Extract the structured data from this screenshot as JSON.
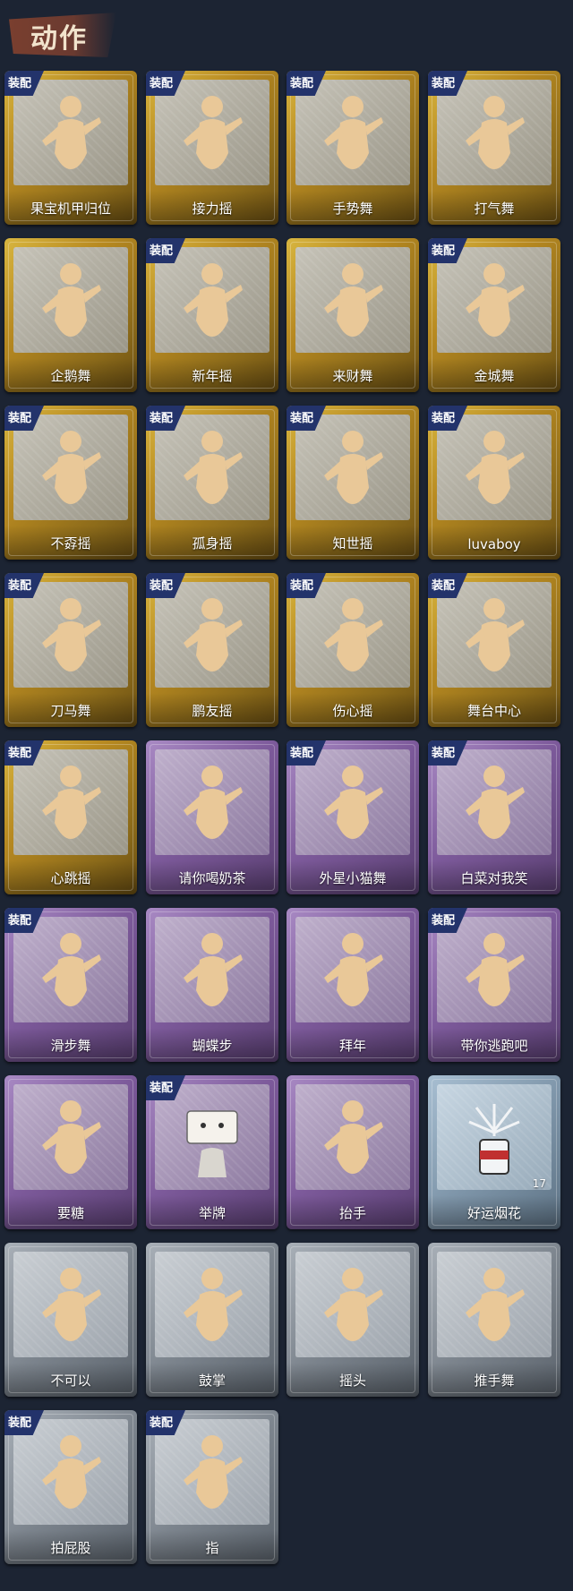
{
  "header": {
    "title": "动作"
  },
  "badge_label": "装配",
  "colors": {
    "gold": "#b88a21",
    "purple": "#7d5a9b",
    "gray": "#7c848d",
    "blue": "#7f96aa",
    "badge": "#23336b"
  },
  "actions": [
    {
      "name": "果宝机甲归位",
      "rarity": "gold",
      "equipped": true,
      "icon": "dancer-icon"
    },
    {
      "name": "接力摇",
      "rarity": "gold",
      "equipped": true,
      "icon": "dancer-icon"
    },
    {
      "name": "手势舞",
      "rarity": "gold",
      "equipped": true,
      "icon": "dancer-icon"
    },
    {
      "name": "打气舞",
      "rarity": "gold",
      "equipped": true,
      "icon": "dancer-icon"
    },
    {
      "name": "企鹅舞",
      "rarity": "gold",
      "equipped": false,
      "icon": "dancer-icon"
    },
    {
      "name": "新年摇",
      "rarity": "gold",
      "equipped": true,
      "icon": "dancer-icon"
    },
    {
      "name": "来财舞",
      "rarity": "gold",
      "equipped": false,
      "icon": "dancer-icon"
    },
    {
      "name": "金城舞",
      "rarity": "gold",
      "equipped": true,
      "icon": "dancer-icon"
    },
    {
      "name": "不孬摇",
      "rarity": "gold",
      "equipped": true,
      "icon": "dancer-icon"
    },
    {
      "name": "孤身摇",
      "rarity": "gold",
      "equipped": true,
      "icon": "dancer-icon"
    },
    {
      "name": "知世摇",
      "rarity": "gold",
      "equipped": true,
      "icon": "dancer-icon"
    },
    {
      "name": "luvaboy",
      "rarity": "gold",
      "equipped": true,
      "icon": "dancer-icon"
    },
    {
      "name": "刀马舞",
      "rarity": "gold",
      "equipped": true,
      "icon": "dancer-icon"
    },
    {
      "name": "鹏友摇",
      "rarity": "gold",
      "equipped": true,
      "icon": "dancer-icon"
    },
    {
      "name": "伤心摇",
      "rarity": "gold",
      "equipped": true,
      "icon": "heart-dancer-icon"
    },
    {
      "name": "舞台中心",
      "rarity": "gold",
      "equipped": true,
      "icon": "dancer-icon"
    },
    {
      "name": "心跳摇",
      "rarity": "gold",
      "equipped": true,
      "icon": "dancer-icon"
    },
    {
      "name": "请你喝奶茶",
      "rarity": "purple",
      "equipped": false,
      "icon": "dancer-icon"
    },
    {
      "name": "外星小猫舞",
      "rarity": "purple",
      "equipped": true,
      "icon": "dancer-icon"
    },
    {
      "name": "白菜对我笑",
      "rarity": "purple",
      "equipped": true,
      "icon": "dancer-icon"
    },
    {
      "name": "滑步舞",
      "rarity": "purple",
      "equipped": true,
      "icon": "dancer-icon"
    },
    {
      "name": "蝴蝶步",
      "rarity": "purple",
      "equipped": false,
      "icon": "dancer-icon"
    },
    {
      "name": "拜年",
      "rarity": "purple",
      "equipped": false,
      "icon": "dancer-icon"
    },
    {
      "name": "带你逃跑吧",
      "rarity": "purple",
      "equipped": true,
      "icon": "dancer-icon"
    },
    {
      "name": "要糖",
      "rarity": "purple",
      "equipped": false,
      "icon": "dancer-icon"
    },
    {
      "name": "举牌",
      "rarity": "purple",
      "equipped": true,
      "icon": "sign-icon"
    },
    {
      "name": "抬手",
      "rarity": "purple",
      "equipped": false,
      "icon": "dancer-icon"
    },
    {
      "name": "好运烟花",
      "rarity": "blue",
      "equipped": false,
      "icon": "firework-icon",
      "count": "17"
    },
    {
      "name": "不可以",
      "rarity": "gray",
      "equipped": false,
      "icon": "finger-icon"
    },
    {
      "name": "鼓掌",
      "rarity": "gray",
      "equipped": false,
      "icon": "clap-icon"
    },
    {
      "name": "摇头",
      "rarity": "gray",
      "equipped": false,
      "icon": "dancer-icon"
    },
    {
      "name": "推手舞",
      "rarity": "gray",
      "equipped": false,
      "icon": "dancer-icon"
    },
    {
      "name": "拍屁股",
      "rarity": "gray",
      "equipped": true,
      "icon": "dancer-icon"
    },
    {
      "name": "指",
      "rarity": "gray",
      "equipped": true,
      "icon": "point-icon"
    }
  ]
}
